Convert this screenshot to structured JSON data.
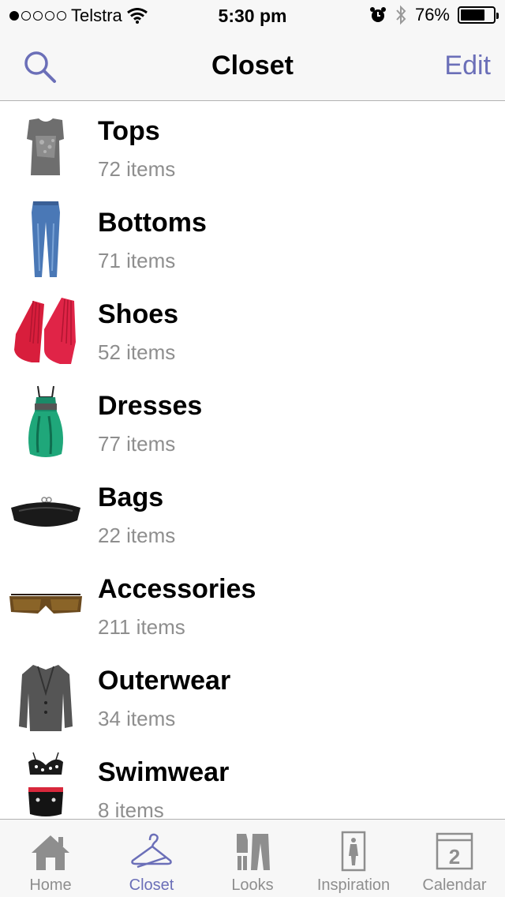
{
  "status_bar": {
    "carrier": "Telstra",
    "signal_strength": 1,
    "signal_max": 5,
    "time": "5:30 pm",
    "battery_percent": "76%",
    "battery_level": 0.76
  },
  "nav": {
    "title": "Closet",
    "edit_label": "Edit",
    "search_icon": "search-icon"
  },
  "categories": [
    {
      "name": "Tops",
      "count": "72 items",
      "icon": "top-thumbnail"
    },
    {
      "name": "Bottoms",
      "count": "71 items",
      "icon": "jeans-thumbnail"
    },
    {
      "name": "Shoes",
      "count": "52 items",
      "icon": "shoes-thumbnail"
    },
    {
      "name": "Dresses",
      "count": "77 items",
      "icon": "dress-thumbnail"
    },
    {
      "name": "Bags",
      "count": "22 items",
      "icon": "bag-thumbnail"
    },
    {
      "name": "Accessories",
      "count": "211 items",
      "icon": "sunglasses-thumbnail"
    },
    {
      "name": "Outerwear",
      "count": "34 items",
      "icon": "jacket-thumbnail"
    },
    {
      "name": "Swimwear",
      "count": "8 items",
      "icon": "swimsuit-thumbnail"
    }
  ],
  "tabs": [
    {
      "label": "Home",
      "icon": "home-icon",
      "active": false
    },
    {
      "label": "Closet",
      "icon": "hanger-icon",
      "active": true
    },
    {
      "label": "Looks",
      "icon": "looks-icon",
      "active": false
    },
    {
      "label": "Inspiration",
      "icon": "inspiration-icon",
      "active": false
    },
    {
      "label": "Calendar",
      "icon": "calendar-icon",
      "active": false,
      "badge": "2"
    }
  ],
  "colors": {
    "accent": "#6b6fb8",
    "secondary_text": "#8e8e8e",
    "bar_background": "#f7f7f7"
  }
}
